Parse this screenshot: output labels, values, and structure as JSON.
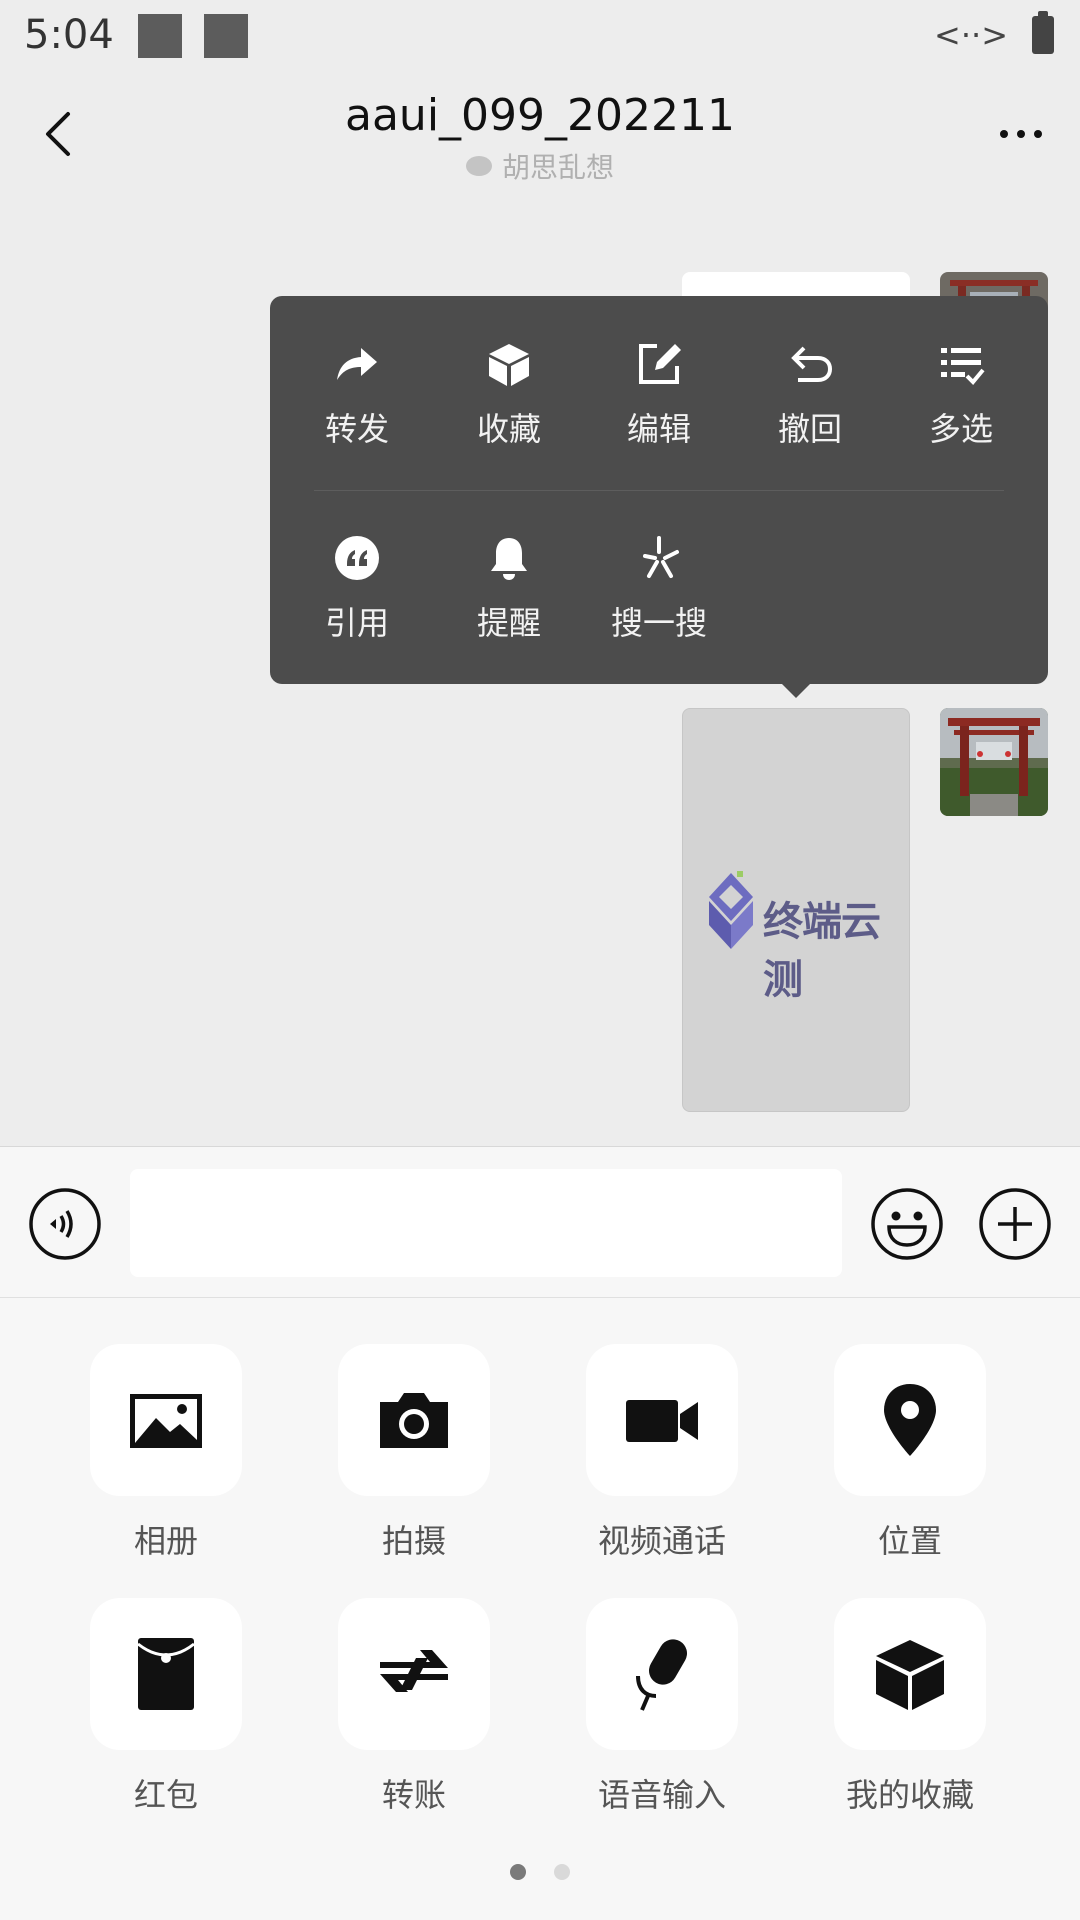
{
  "status_bar": {
    "time": "5:04",
    "network": "<··>"
  },
  "header": {
    "title": "aaui_099_202211",
    "subtitle": "胡思乱想"
  },
  "image_message": {
    "logo_text": "终端云测"
  },
  "context_menu": {
    "row1": [
      {
        "label": "转发",
        "icon": "forward-icon"
      },
      {
        "label": "收藏",
        "icon": "cube-icon"
      },
      {
        "label": "编辑",
        "icon": "edit-icon"
      },
      {
        "label": "撤回",
        "icon": "undo-icon"
      },
      {
        "label": "多选",
        "icon": "multi-select-icon"
      }
    ],
    "row2": [
      {
        "label": "引用",
        "icon": "quote-icon"
      },
      {
        "label": "提醒",
        "icon": "bell-icon"
      },
      {
        "label": "搜一搜",
        "icon": "sparkle-search-icon"
      }
    ]
  },
  "input_bar": {
    "value": "",
    "placeholder": ""
  },
  "panel": {
    "items": [
      {
        "label": "相册",
        "icon": "photo-album-icon"
      },
      {
        "label": "拍摄",
        "icon": "camera-icon"
      },
      {
        "label": "视频通话",
        "icon": "video-call-icon"
      },
      {
        "label": "位置",
        "icon": "location-pin-icon"
      },
      {
        "label": "红包",
        "icon": "red-packet-icon"
      },
      {
        "label": "转账",
        "icon": "transfer-icon"
      },
      {
        "label": "语音输入",
        "icon": "microphone-icon"
      },
      {
        "label": "我的收藏",
        "icon": "favorites-icon"
      }
    ],
    "page_count": 2,
    "active_page": 1
  },
  "colors": {
    "background": "#ededed",
    "menu_background": "#4c4c4c",
    "menu_text": "#f2f2f2",
    "panel_background": "#f7f7f7",
    "logo_text": "#5d5c88"
  }
}
